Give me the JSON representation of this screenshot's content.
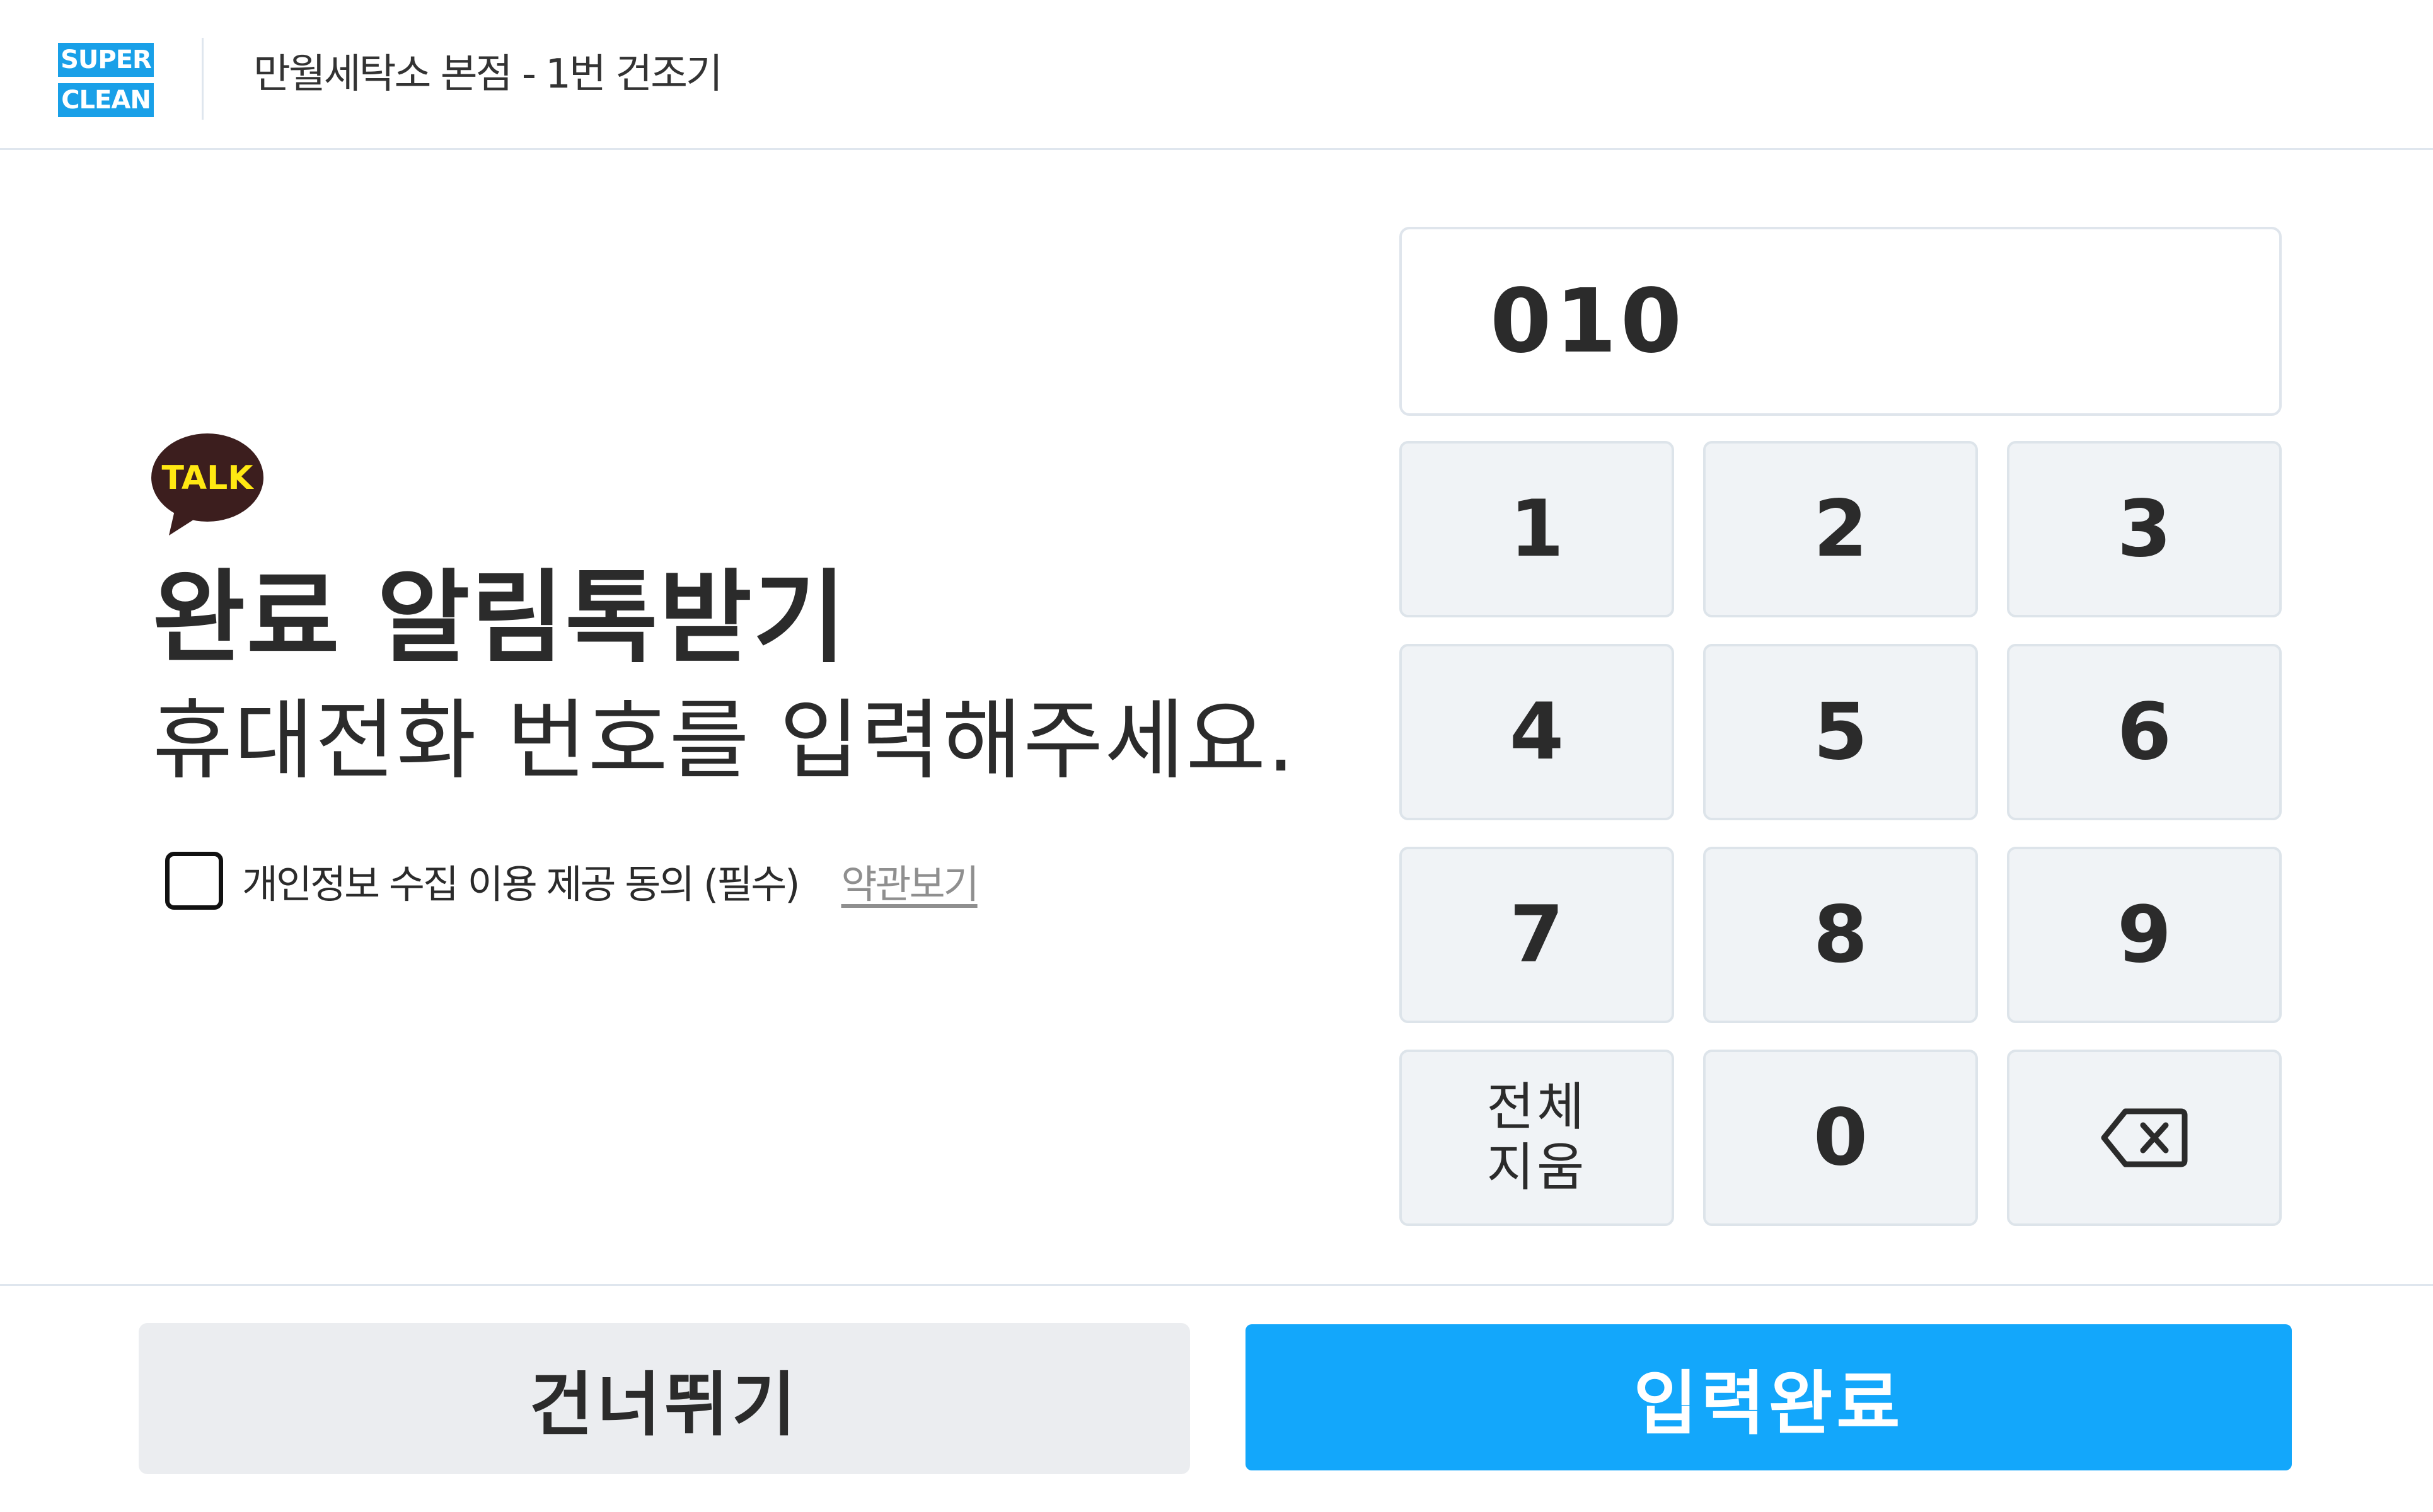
{
  "header": {
    "logo_line1": "SUPER",
    "logo_line2": "CLEAN",
    "store_name": "만월세탁소 본점 - 1번 건조기"
  },
  "main": {
    "talk_badge": "TALK",
    "title": "완료 알림톡받기",
    "subtitle": "휴대전화 번호를 입력해주세요.",
    "consent_label": "개인정보 수집 이용 제공 동의 (필수)",
    "consent_checked": false,
    "terms_link": "약관보기"
  },
  "phone": {
    "value": "010"
  },
  "keypad": {
    "keys": [
      "1",
      "2",
      "3",
      "4",
      "5",
      "6",
      "7",
      "8",
      "9"
    ],
    "clear_line1": "전체",
    "clear_line2": "지움",
    "zero": "0",
    "backspace_icon": "backspace-icon"
  },
  "footer": {
    "skip_label": "건너뛰기",
    "done_label": "입력완료"
  },
  "colors": {
    "brand_blue": "#19a0e8",
    "primary_button": "#13a7fb",
    "talk_bubble": "#3c1e1e",
    "talk_text": "#ffe812"
  }
}
